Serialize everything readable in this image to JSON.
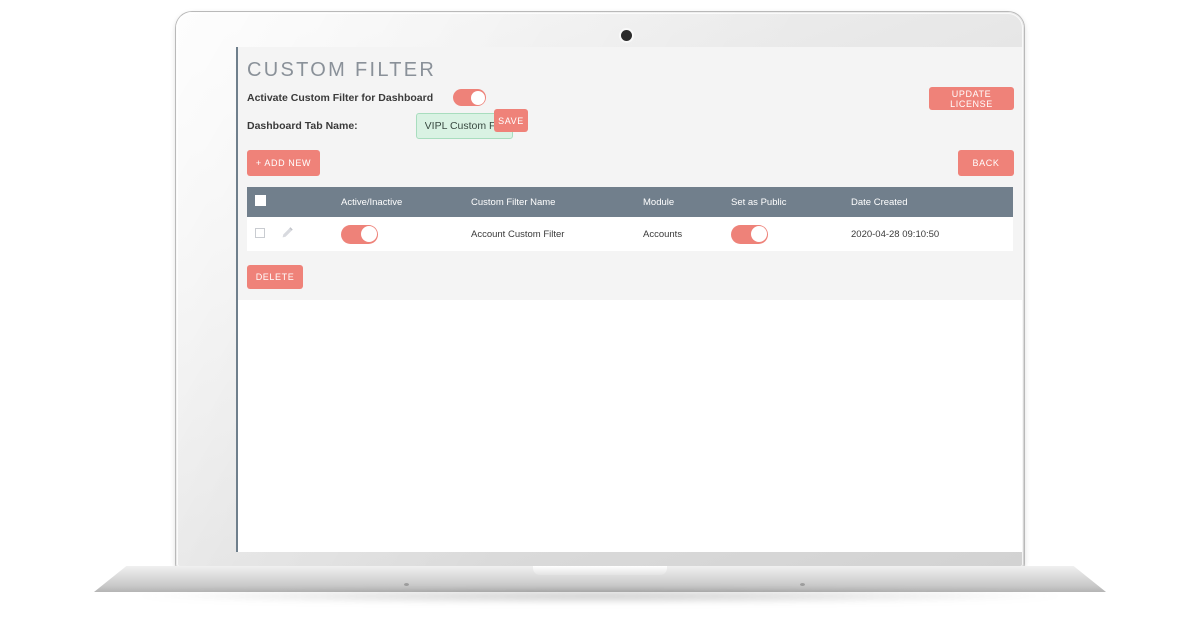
{
  "device": {
    "type": "laptop-mockup",
    "webcam_icon": "camera-dot-icon"
  },
  "page": {
    "title": "CUSTOM FILTER"
  },
  "settings": {
    "activate_label": "Activate Custom Filter for Dashboard",
    "activate_toggle_on": true,
    "tab_name_label": "Dashboard Tab Name:",
    "tab_name_value": "VIPL Custom Filter",
    "tab_name_placeholder": "Dashboard Tab Name",
    "save_label": "SAVE"
  },
  "toolbar": {
    "update_license_label": "UPDATE LICENSE",
    "add_new_label": "+ ADD NEW",
    "back_label": "BACK",
    "delete_label": "DELETE"
  },
  "table": {
    "columns": [
      {
        "key": "select",
        "label": ""
      },
      {
        "key": "edit",
        "label": ""
      },
      {
        "key": "active",
        "label": "Active/Inactive"
      },
      {
        "key": "name",
        "label": "Custom Filter Name"
      },
      {
        "key": "module",
        "label": "Module"
      },
      {
        "key": "public",
        "label": "Set as Public"
      },
      {
        "key": "created",
        "label": "Date Created"
      }
    ],
    "select_all_checked": true,
    "rows": [
      {
        "selected": false,
        "edit_icon": "pencil-icon",
        "active": true,
        "name": "Account Custom Filter",
        "module": "Accounts",
        "public": true,
        "created": "2020-04-28 09:10:50"
      }
    ]
  },
  "colors": {
    "accent": "#ef8279",
    "table_header": "#717f8c",
    "panel_bg": "#f4f4f4",
    "input_bg": "#d9f2e3",
    "input_border": "#a8ddbe",
    "title_text": "#8a9199"
  }
}
